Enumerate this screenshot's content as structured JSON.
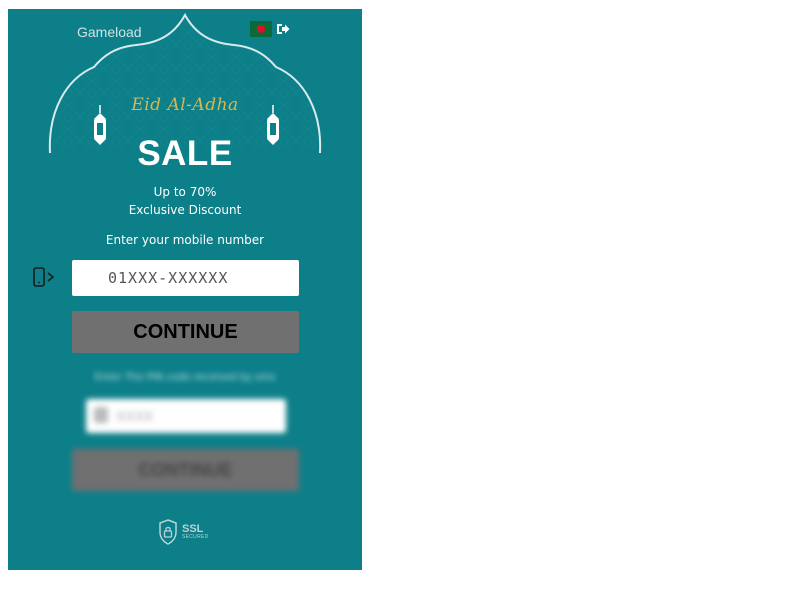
{
  "header": {
    "brand": "Gameload",
    "flag_icon": "bangladesh-flag-icon",
    "exit_icon": "sign-out-icon"
  },
  "banner": {
    "greeting": "Eid Al-Adha",
    "headline": "SALE",
    "line1": "Up to 70%",
    "line2": "Exclusive Discount"
  },
  "form": {
    "label": "Enter your mobile number",
    "mobile_placeholder": "01XXX-XXXXXX",
    "phone_icon": "mobile-phone-icon",
    "continue_label": "CONTINUE"
  },
  "pin_form": {
    "label": "Enter The PIN code received by sms",
    "pin_placeholder": "XXXX",
    "continue_label": "CONTINUE"
  },
  "footer": {
    "badge_main": "SSL",
    "badge_sub": "SECURED",
    "badge_icon": "ssl-lock-shield-icon"
  },
  "colors": {
    "panel_bg": "#0d7f89",
    "button_bg": "#707070",
    "accent_gold": "#d8b650"
  }
}
